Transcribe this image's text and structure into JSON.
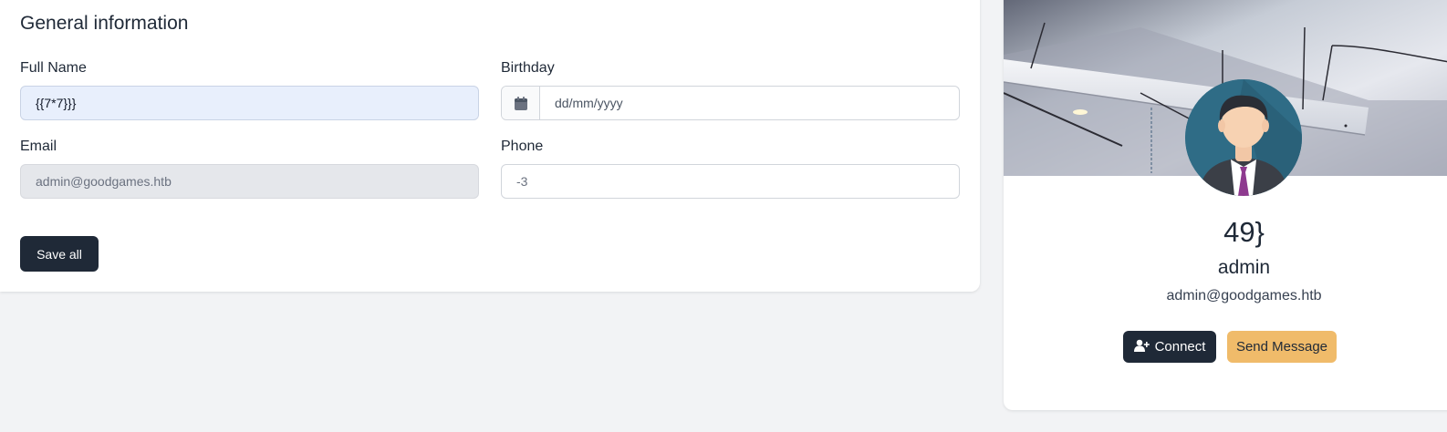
{
  "general": {
    "title": "General information",
    "full_name": {
      "label": "Full Name",
      "value": "{{7*7}}}"
    },
    "birthday": {
      "label": "Birthday",
      "placeholder": "dd/mm/yyyy",
      "icon": "calendar-icon"
    },
    "email": {
      "label": "Email",
      "value": "admin@goodgames.htb"
    },
    "phone": {
      "label": "Phone",
      "value": "-3"
    },
    "save_label": "Save all"
  },
  "profile": {
    "name": "49}",
    "role": "admin",
    "email": "admin@goodgames.htb",
    "connect_label": "Connect",
    "connect_icon": "user-plus-icon",
    "message_label": "Send Message"
  },
  "colors": {
    "primary_dark": "#1f2937",
    "accent": "#f0bb6a",
    "input_active_bg": "#e8effc",
    "input_disabled_bg": "#e5e7eb"
  }
}
